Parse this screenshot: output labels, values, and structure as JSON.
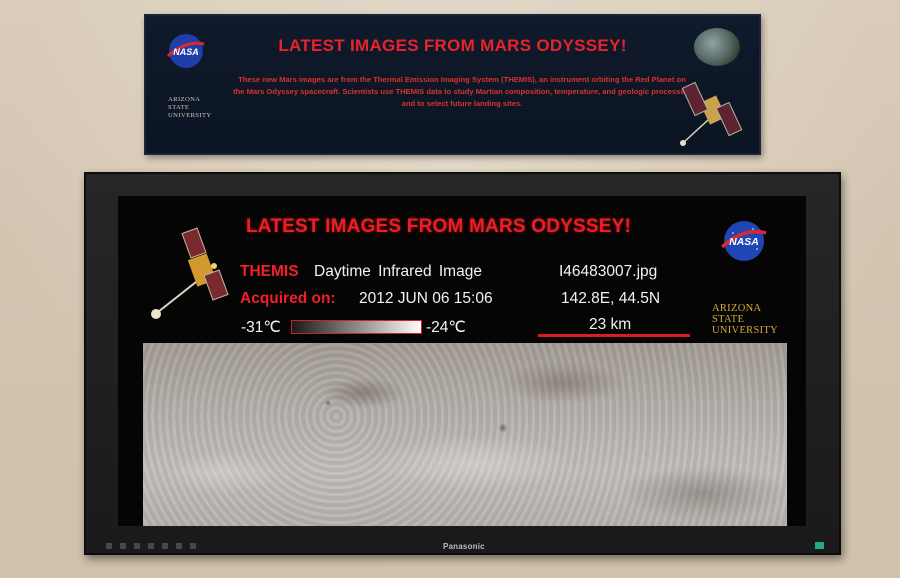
{
  "sign": {
    "title": "LATEST IMAGES FROM MARS ODYSSEY!",
    "body": "These new Mars images are from the Thermal Emission Imaging System (THEMIS), an instrument orbiting the Red Planet on the Mars Odyssey spacecraft.  Scientists use THEMIS data to study Martian composition, temperature, and geologic processes, and to select future landing sites.",
    "nasa_logo": "NASA",
    "asu_line1": "Arizona",
    "asu_line2": "State",
    "asu_line3": "University"
  },
  "screen": {
    "title": "LATEST IMAGES FROM MARS ODYSSEY!",
    "instrument": "THEMIS",
    "image_type": "Daytime  Infrared  Image",
    "filename": "I46483007.jpg",
    "acquired_label": "Acquired on:",
    "acquired_value": "2012 JUN 06 15:06",
    "coords": "142.8E, 44.5N",
    "temp_min": "-31℃",
    "temp_max": "-24℃",
    "scale": "23 km",
    "nasa_logo": "NASA",
    "asu_line1": "Arizona",
    "asu_line2": "State",
    "asu_line3": "University"
  },
  "tv": {
    "brand": "Panasonic"
  },
  "colors": {
    "accent_red": "#ee1c24",
    "asu_gold": "#d8a93c",
    "sign_bg": "#0f1a2c"
  }
}
